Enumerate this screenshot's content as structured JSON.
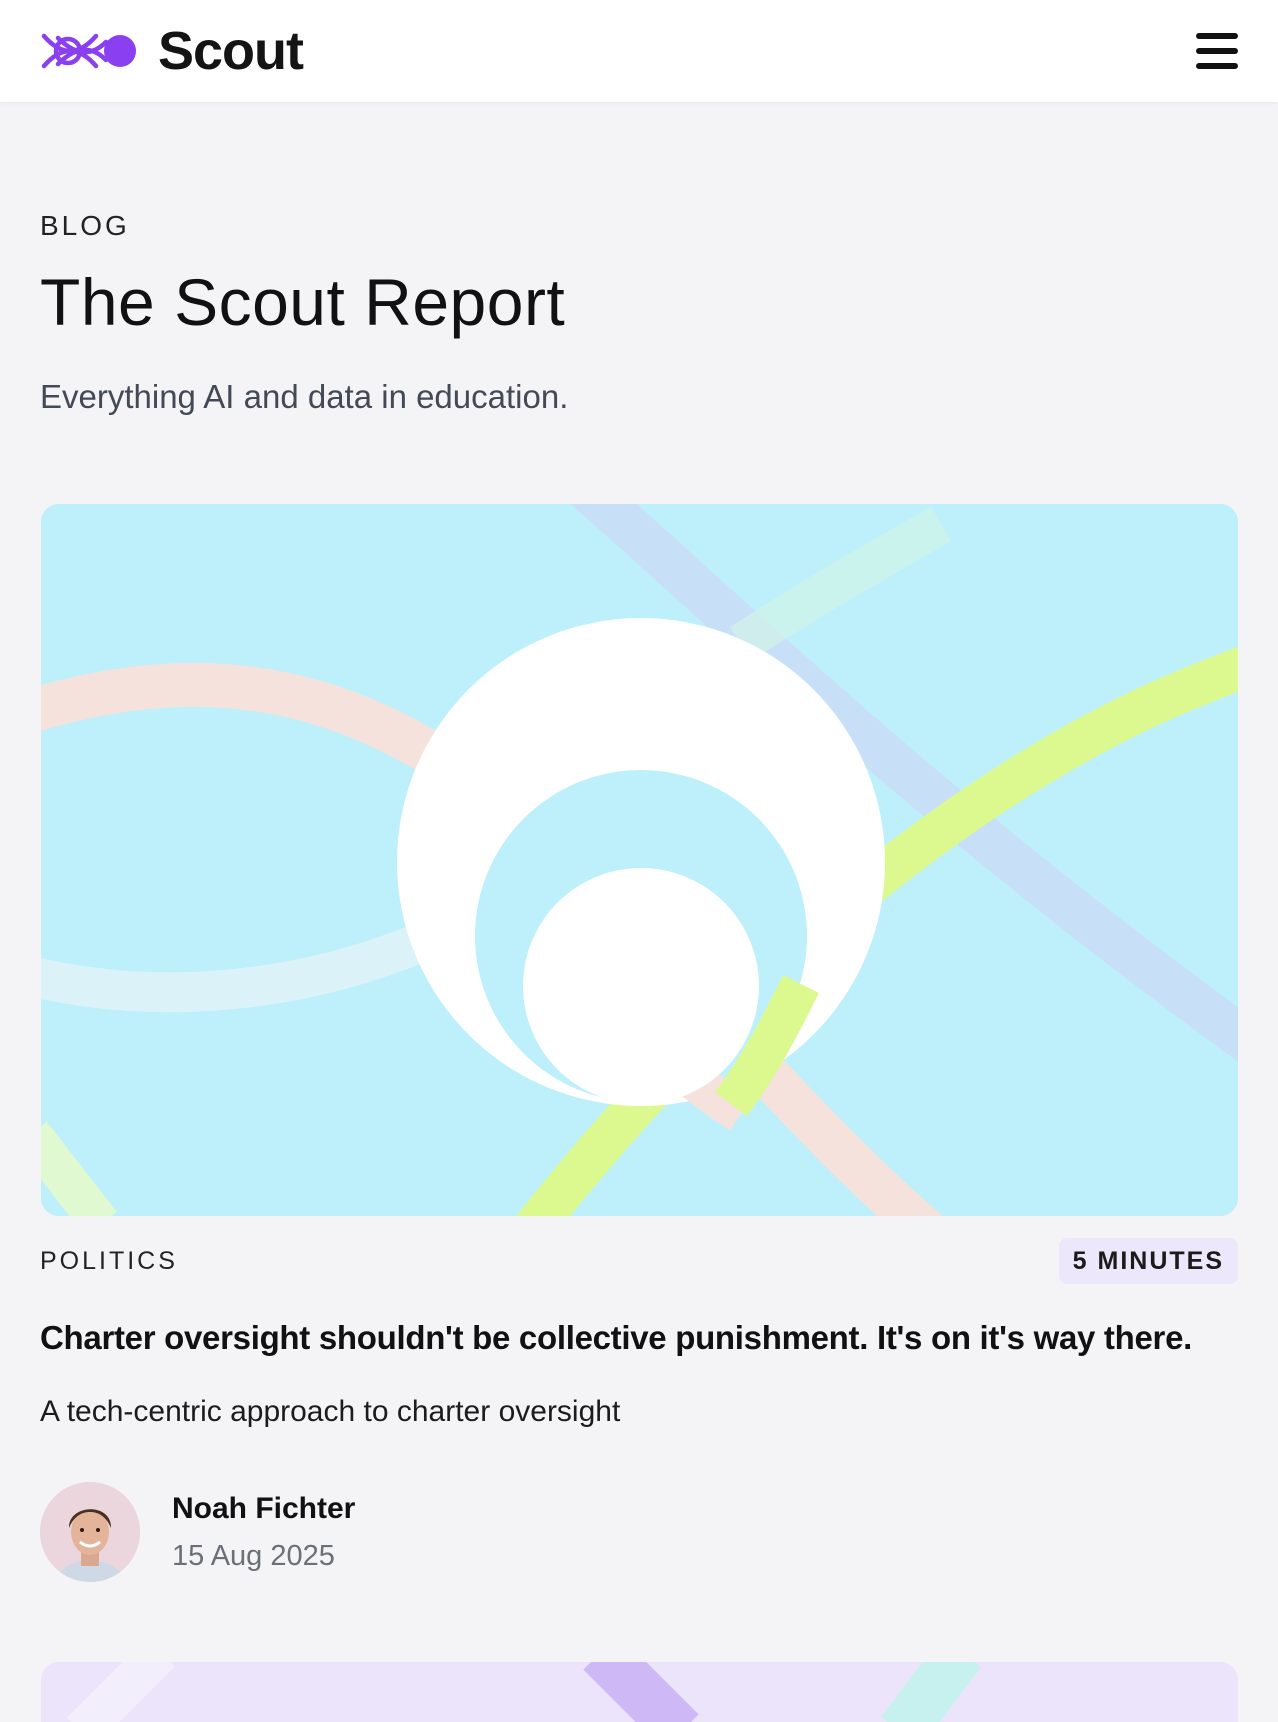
{
  "header": {
    "brand_name": "Scout",
    "logo_icon": "scout-logo-icon",
    "menu_icon": "hamburger-menu-icon",
    "brand_color": "#8a3ff0"
  },
  "page": {
    "eyebrow": "BLOG",
    "title": "The Scout Report",
    "subtitle": "Everything AI and data in education."
  },
  "featured_post": {
    "category": "POLITICS",
    "read_time": "5 MINUTES",
    "title": "Charter oversight shouldn't be collective punishment. It's on it's way there.",
    "description": "A tech-centric approach to charter oversight",
    "author": {
      "name": "Noah Fichter",
      "date": "15 Aug 2025"
    },
    "image_colors": {
      "background": "#bdf0fa",
      "circle": "#ffffff",
      "ribbon_peach": "#f6e2dc",
      "ribbon_lime": "#dcf98f",
      "ribbon_lilac": "#c9dcf7"
    }
  }
}
